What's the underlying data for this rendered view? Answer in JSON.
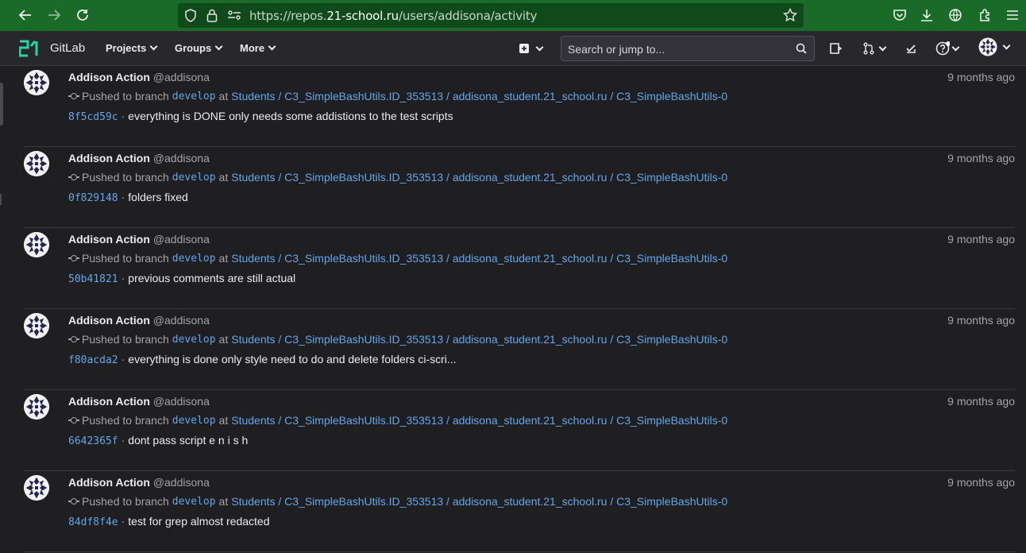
{
  "browser": {
    "url_prefix": "https://repos.",
    "url_host": "21-school.ru",
    "url_path": "/users/addisona/activity"
  },
  "header": {
    "brand": "GitLab",
    "menus": [
      {
        "label": "Projects"
      },
      {
        "label": "Groups"
      },
      {
        "label": "More"
      }
    ],
    "search_placeholder": "Search or jump to..."
  },
  "events": [
    {
      "author": "Addison Action",
      "handle": "@addisona",
      "time": "9 months ago",
      "action": "Pushed to branch",
      "branch": "develop",
      "at": "at",
      "project": "Students / C3_SimpleBashUtils.ID_353513 / addisona_student.21_school.ru / C3_SimpleBashUtils-0",
      "sha": "8f5cd59c",
      "message": "everything is DONE only needs some addistions to the test scripts"
    },
    {
      "author": "Addison Action",
      "handle": "@addisona",
      "time": "9 months ago",
      "action": "Pushed to branch",
      "branch": "develop",
      "at": "at",
      "project": "Students / C3_SimpleBashUtils.ID_353513 / addisona_student.21_school.ru / C3_SimpleBashUtils-0",
      "sha": "0f829148",
      "message": "folders fixed"
    },
    {
      "author": "Addison Action",
      "handle": "@addisona",
      "time": "9 months ago",
      "action": "Pushed to branch",
      "branch": "develop",
      "at": "at",
      "project": "Students / C3_SimpleBashUtils.ID_353513 / addisona_student.21_school.ru / C3_SimpleBashUtils-0",
      "sha": "50b41821",
      "message": "previous comments are still actual"
    },
    {
      "author": "Addison Action",
      "handle": "@addisona",
      "time": "9 months ago",
      "action": "Pushed to branch",
      "branch": "develop",
      "at": "at",
      "project": "Students / C3_SimpleBashUtils.ID_353513 / addisona_student.21_school.ru / C3_SimpleBashUtils-0",
      "sha": "f80acda2",
      "message": "everything is done only style need to do and delete folders ci-scri..."
    },
    {
      "author": "Addison Action",
      "handle": "@addisona",
      "time": "9 months ago",
      "action": "Pushed to branch",
      "branch": "develop",
      "at": "at",
      "project": "Students / C3_SimpleBashUtils.ID_353513 / addisona_student.21_school.ru / C3_SimpleBashUtils-0",
      "sha": "6642365f",
      "message": "dont pass script e n i s h"
    },
    {
      "author": "Addison Action",
      "handle": "@addisona",
      "time": "9 months ago",
      "action": "Pushed to branch",
      "branch": "develop",
      "at": "at",
      "project": "Students / C3_SimpleBashUtils.ID_353513 / addisona_student.21_school.ru / C3_SimpleBashUtils-0",
      "sha": "84df8f4e",
      "message": "test for grep almost redacted"
    }
  ]
}
